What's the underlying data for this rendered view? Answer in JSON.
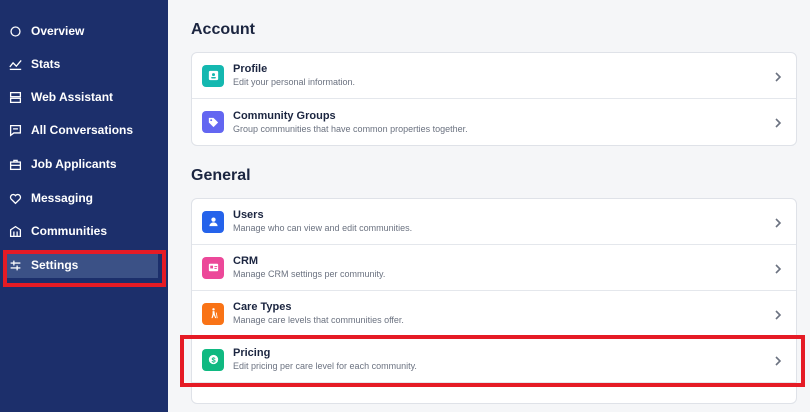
{
  "sidebar": {
    "items": [
      {
        "label": "Overview",
        "icon": "circle-icon"
      },
      {
        "label": "Stats",
        "icon": "stats-icon"
      },
      {
        "label": "Web Assistant",
        "icon": "web-assistant-icon"
      },
      {
        "label": "All Conversations",
        "icon": "chat-icon"
      },
      {
        "label": "Job Applicants",
        "icon": "briefcase-icon"
      },
      {
        "label": "Messaging",
        "icon": "heart-icon"
      },
      {
        "label": "Communities",
        "icon": "building-icon"
      },
      {
        "label": "Settings",
        "icon": "settings-sliders-icon",
        "active": true
      }
    ]
  },
  "main": {
    "sections": [
      {
        "title": "Account",
        "rows": [
          {
            "title": "Profile",
            "subtitle": "Edit your personal information.",
            "icon": "profile-icon",
            "color": "#14b8b0"
          },
          {
            "title": "Community Groups",
            "subtitle": "Group communities that have common properties together.",
            "icon": "tag-icon",
            "color": "#6366f1"
          }
        ]
      },
      {
        "title": "General",
        "rows": [
          {
            "title": "Users",
            "subtitle": "Manage who can view and edit communities.",
            "icon": "user-icon",
            "color": "#2563eb"
          },
          {
            "title": "CRM",
            "subtitle": "Manage CRM settings per community.",
            "icon": "crm-icon",
            "color": "#ec4899"
          },
          {
            "title": "Care Types",
            "subtitle": "Manage care levels that communities offer.",
            "icon": "walking-icon",
            "color": "#f97316"
          },
          {
            "title": "Pricing",
            "subtitle": "Edit pricing per care level for each community.",
            "icon": "dollar-icon",
            "color": "#10b981"
          }
        ]
      }
    ]
  },
  "colors": {
    "sidebar_bg": "#1c2f6b",
    "sidebar_active": "#3b5186",
    "highlight": "#e51b25"
  }
}
